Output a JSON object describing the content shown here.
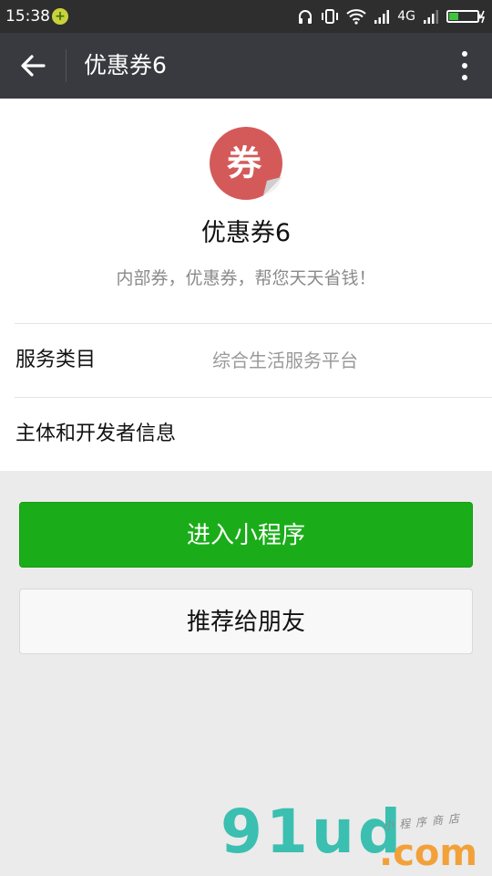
{
  "status_bar": {
    "time": "15:38",
    "network": "4G",
    "icons": [
      "headphones-icon",
      "vibrate-icon",
      "wifi-icon",
      "signal-icon",
      "battery-charging-icon"
    ]
  },
  "title_bar": {
    "title": "优惠券6",
    "back_icon": "arrow-left-icon",
    "menu_icon": "more-vertical-icon"
  },
  "app": {
    "logo_char": "券",
    "logo_color": "#d45a5a",
    "name": "优惠券6",
    "description": "内部券，优惠券，帮您天天省钱！"
  },
  "info_rows": [
    {
      "label": "服务类目",
      "value": "综合生活服务平台"
    },
    {
      "label": "主体和开发者信息",
      "value": ""
    }
  ],
  "buttons": {
    "enter": "进入小程序",
    "recommend": "推荐给朋友"
  },
  "watermark": {
    "main": "91ud",
    "domain": ".com",
    "sub": "小程序商店"
  },
  "colors": {
    "titlebar": "#393a3f",
    "primary_button": "#1aad19",
    "background": "#ebebeb"
  }
}
